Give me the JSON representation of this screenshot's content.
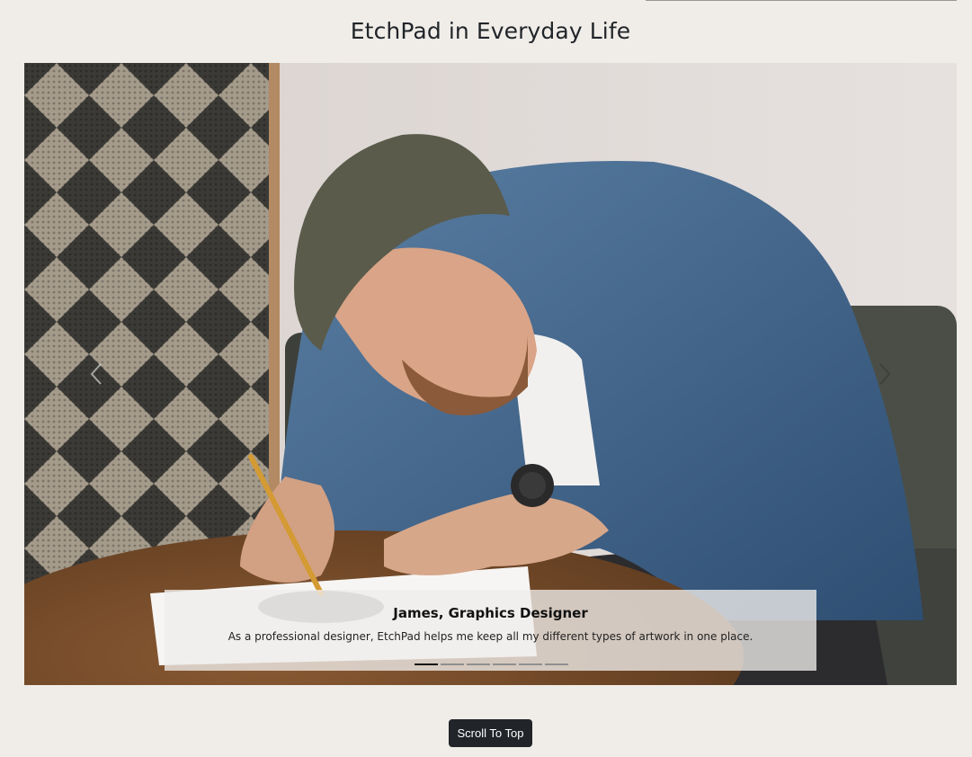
{
  "section": {
    "title": "EtchPad in Everyday Life"
  },
  "carousel": {
    "active_index": 0,
    "slide_count": 6,
    "slide": {
      "name": "James, Graphics Designer",
      "quote": "As a professional designer, EtchPad helps me keep all my different types of artwork in one place."
    },
    "prev_icon": "chevron-left-icon",
    "next_icon": "chevron-right-icon"
  },
  "footer": {
    "scroll_top_label": "Scroll To Top"
  },
  "colors": {
    "page_background": "#f0ede9",
    "button_background": "#212529",
    "active_indicator": "#111111"
  }
}
